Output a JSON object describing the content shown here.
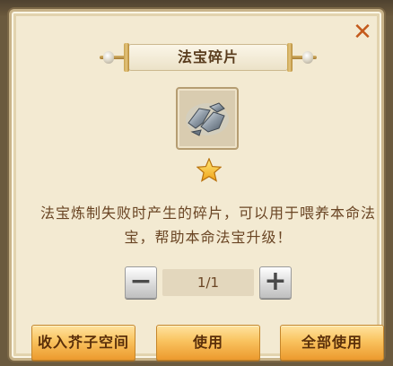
{
  "dialog": {
    "title": "法宝碎片",
    "close_symbol": "✕",
    "item": {
      "icon": "treasure-fragment-icon",
      "stars": 1
    },
    "description_lines": [
      "法宝炼制失败时产生的碎片，可以用于喂养本命法",
      "宝，帮助本命法宝升级！"
    ],
    "quantity": {
      "minus_label": "−",
      "value": "1/1",
      "plus_label": "+"
    },
    "buttons": {
      "store": "收入芥子空间",
      "use": "使用",
      "use_all": "全部使用"
    }
  },
  "colors": {
    "panel_bg": "#f3ead2",
    "text_brown": "#6a4524",
    "button_gold": "#f9c35f",
    "close_orange": "#c45a1c"
  }
}
